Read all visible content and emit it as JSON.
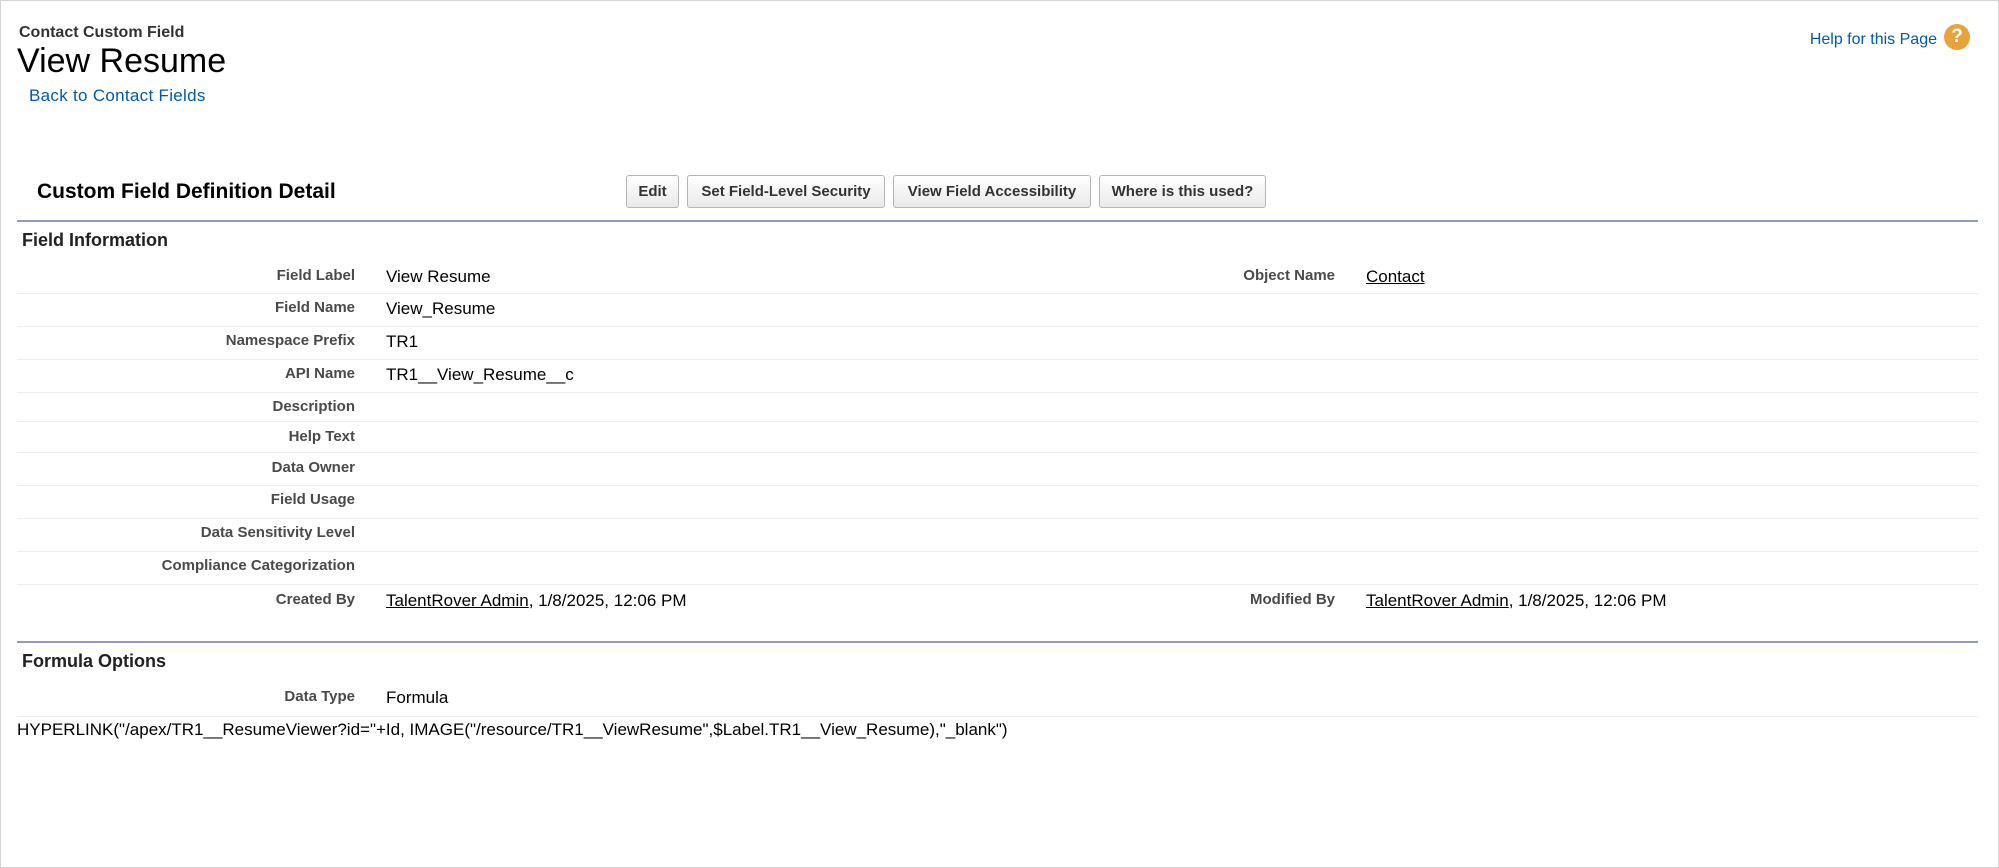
{
  "header": {
    "object_type": "Contact Custom Field",
    "title": "View Resume",
    "back_link": "Back to Contact Fields",
    "help_link": "Help for this Page",
    "help_icon": "question-icon"
  },
  "page_block": {
    "title": "Custom Field Definition Detail",
    "buttons": {
      "edit": "Edit",
      "set_fls": "Set Field-Level Security",
      "view_access": "View Field Accessibility",
      "where_used": "Where is this used?"
    }
  },
  "field_information": {
    "title": "Field Information",
    "field_label": {
      "label": "Field Label",
      "value": "View Resume"
    },
    "object_name": {
      "label": "Object Name",
      "value": "Contact"
    },
    "field_name": {
      "label": "Field Name",
      "value": "View_Resume"
    },
    "namespace_prefix": {
      "label": "Namespace Prefix",
      "value": "TR1"
    },
    "api_name": {
      "label": "API Name",
      "value": "TR1__View_Resume__c"
    },
    "description": {
      "label": "Description",
      "value": ""
    },
    "help_text": {
      "label": "Help Text",
      "value": ""
    },
    "data_owner": {
      "label": "Data Owner",
      "value": ""
    },
    "field_usage": {
      "label": "Field Usage",
      "value": ""
    },
    "data_sensitivity": {
      "label": "Data Sensitivity Level",
      "value": ""
    },
    "compliance": {
      "label": "Compliance Categorization",
      "value": ""
    },
    "created_by": {
      "label": "Created By",
      "user": "TalentRover Admin",
      "date": ", 1/8/2025, 12:06 PM"
    },
    "modified_by": {
      "label": "Modified By",
      "user": "TalentRover Admin",
      "date": ", 1/8/2025, 12:06 PM"
    }
  },
  "formula_options": {
    "title": "Formula Options",
    "data_type": {
      "label": "Data Type",
      "value": "Formula"
    },
    "formula": "HYPERLINK(\"/apex/TR1__ResumeViewer?id=\"+Id, IMAGE(\"/resource/TR1__ViewResume\",$Label.TR1__View_Resume),\"_blank\")"
  },
  "colors": {
    "link": "#015ba7",
    "section_rule": "#8e9dbe",
    "help_icon": "#e8a33d"
  }
}
